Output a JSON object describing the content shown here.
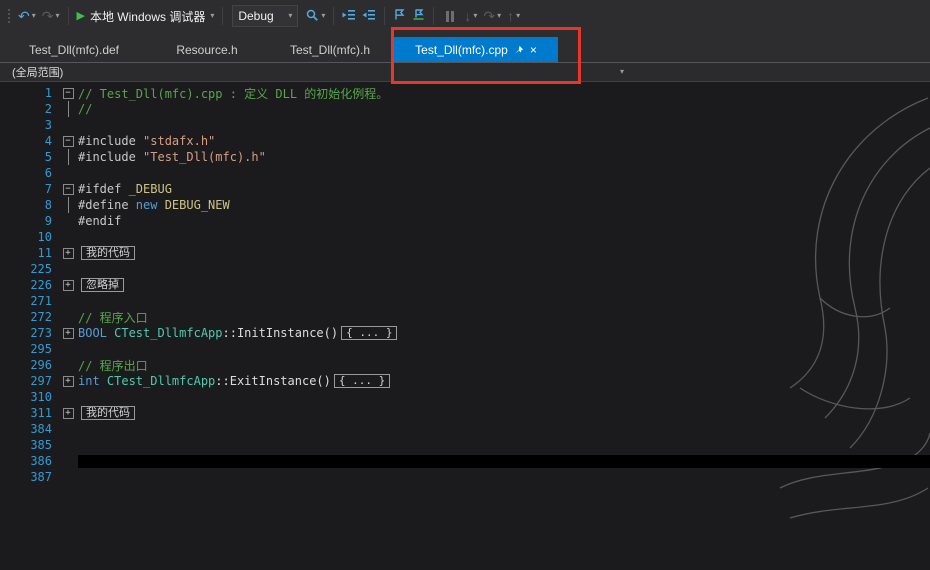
{
  "colors": {
    "accent_blue": "#007ACC",
    "annotation_red": "#E5372B",
    "toolbar_bg": "#2D2D30",
    "editor_bg": "#1B1B1D",
    "comment_green": "#57A64A",
    "string_orange": "#D69D85",
    "keyword_blue": "#569CD6",
    "type_teal": "#4EC9B0",
    "macro_yellow": "#CDC387",
    "line_number_blue": "#2E9BD6"
  },
  "icons": {
    "undo": "↶",
    "redo": "↷",
    "play": "▶",
    "caret": "▾",
    "close": "×",
    "step_into": "↓",
    "step_over": "↷",
    "step_out": "↑"
  },
  "toolbar": {
    "debug_target_label": "本地 Windows 调试器",
    "config_value": "Debug"
  },
  "tabs": {
    "items": [
      {
        "label": "Test_Dll(mfc).def"
      },
      {
        "label": "Resource.h"
      },
      {
        "label": "Test_Dll(mfc).h"
      },
      {
        "label": "Test_Dll(mfc).cpp",
        "active": true
      }
    ]
  },
  "navbar": {
    "scope_value": "(全局范围)"
  },
  "editor": {
    "lines": [
      {
        "n": "1",
        "f": "minus",
        "seg": [
          {
            "c": "comment",
            "t": "// Test_Dll(mfc).cpp : 定义 DLL 的初始化例程。"
          }
        ]
      },
      {
        "n": "2",
        "f": "line",
        "seg": [
          {
            "c": "comment",
            "t": "//"
          }
        ]
      },
      {
        "n": "3",
        "f": "",
        "seg": []
      },
      {
        "n": "4",
        "f": "minus",
        "seg": [
          {
            "c": "pp",
            "t": "#include "
          },
          {
            "c": "str",
            "t": "\"stdafx.h\""
          }
        ]
      },
      {
        "n": "5",
        "f": "line",
        "seg": [
          {
            "c": "pp",
            "t": "#include "
          },
          {
            "c": "str",
            "t": "\"Test_Dll(mfc).h\""
          }
        ]
      },
      {
        "n": "6",
        "f": "",
        "seg": []
      },
      {
        "n": "7",
        "f": "minus",
        "seg": [
          {
            "c": "pp",
            "t": "#ifdef "
          },
          {
            "c": "macro",
            "t": "_DEBUG"
          }
        ]
      },
      {
        "n": "8",
        "f": "line",
        "seg": [
          {
            "c": "pp",
            "t": "#define "
          },
          {
            "c": "kw",
            "t": "new "
          },
          {
            "c": "macro",
            "t": "DEBUG_NEW"
          }
        ]
      },
      {
        "n": "9",
        "f": "",
        "seg": [
          {
            "c": "pp",
            "t": "#endif"
          }
        ]
      },
      {
        "n": "10",
        "f": "",
        "seg": []
      },
      {
        "n": "11",
        "f": "plus",
        "seg": [
          {
            "c": "box",
            "t": "我的代码"
          }
        ]
      },
      {
        "n": "225",
        "f": "",
        "seg": []
      },
      {
        "n": "226",
        "f": "plus",
        "seg": [
          {
            "c": "box",
            "t": "忽略掉"
          }
        ]
      },
      {
        "n": "271",
        "f": "",
        "seg": []
      },
      {
        "n": "272",
        "f": "",
        "seg": [
          {
            "c": "comment",
            "t": "// 程序入口"
          }
        ]
      },
      {
        "n": "273",
        "f": "plus",
        "seg": [
          {
            "c": "kw",
            "t": "BOOL "
          },
          {
            "c": "type",
            "t": "CTest_DllmfcApp"
          },
          {
            "c": "plain",
            "t": "::InitInstance()"
          },
          {
            "c": "box",
            "t": "{ ... }"
          }
        ]
      },
      {
        "n": "295",
        "f": "",
        "seg": []
      },
      {
        "n": "296",
        "f": "",
        "seg": [
          {
            "c": "comment",
            "t": "// 程序出口"
          }
        ]
      },
      {
        "n": "297",
        "f": "plus",
        "seg": [
          {
            "c": "kw",
            "t": "int "
          },
          {
            "c": "type",
            "t": "CTest_DllmfcApp"
          },
          {
            "c": "plain",
            "t": "::ExitInstance()"
          },
          {
            "c": "box",
            "t": "{ ... }"
          }
        ]
      },
      {
        "n": "310",
        "f": "",
        "seg": []
      },
      {
        "n": "311",
        "f": "plus",
        "seg": [
          {
            "c": "box",
            "t": "我的代码"
          }
        ]
      },
      {
        "n": "384",
        "f": "",
        "seg": []
      },
      {
        "n": "385",
        "f": "",
        "seg": []
      },
      {
        "n": "386",
        "f": "",
        "seg": [],
        "current": true
      },
      {
        "n": "387",
        "f": "",
        "seg": []
      }
    ]
  }
}
